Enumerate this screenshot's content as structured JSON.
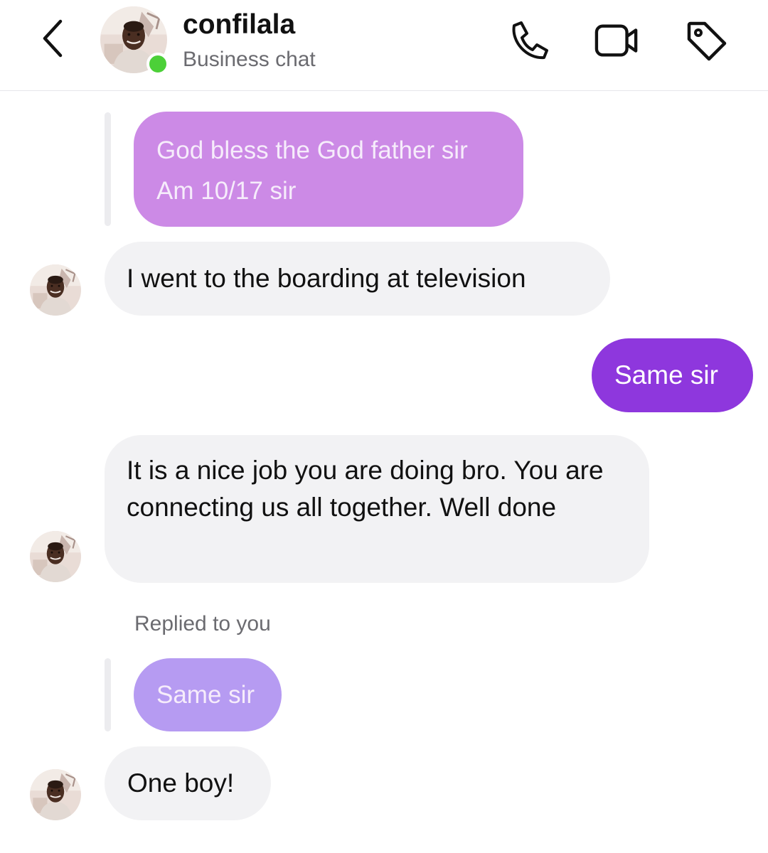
{
  "header": {
    "name": "confilala",
    "subtitle": "Business chat",
    "status_color": "#4cd038",
    "icons": [
      "back-chevron-icon",
      "phone-icon",
      "video-camera-icon",
      "tag-icon"
    ]
  },
  "thread": {
    "quoted_reply_1": {
      "line1": "God bless the God father sir",
      "line2": "Am 10/17 sir",
      "color": "#cc8ae6"
    },
    "msg_boarding": "I went to the boarding at television",
    "msg_same_sir": "Same sir",
    "msg_nice_job": "It is a nice job you are doing bro. You are connecting us all together. Well done",
    "replied_label": "Replied to you",
    "quoted_reply_2": {
      "text": "Same sir",
      "color": "#b69bf2"
    },
    "msg_one_boy": "One boy!"
  },
  "colors": {
    "outgoing_bubble": "#8e37dd",
    "incoming_bubble": "#f2f2f4",
    "muted_text": "#6b6b70"
  }
}
